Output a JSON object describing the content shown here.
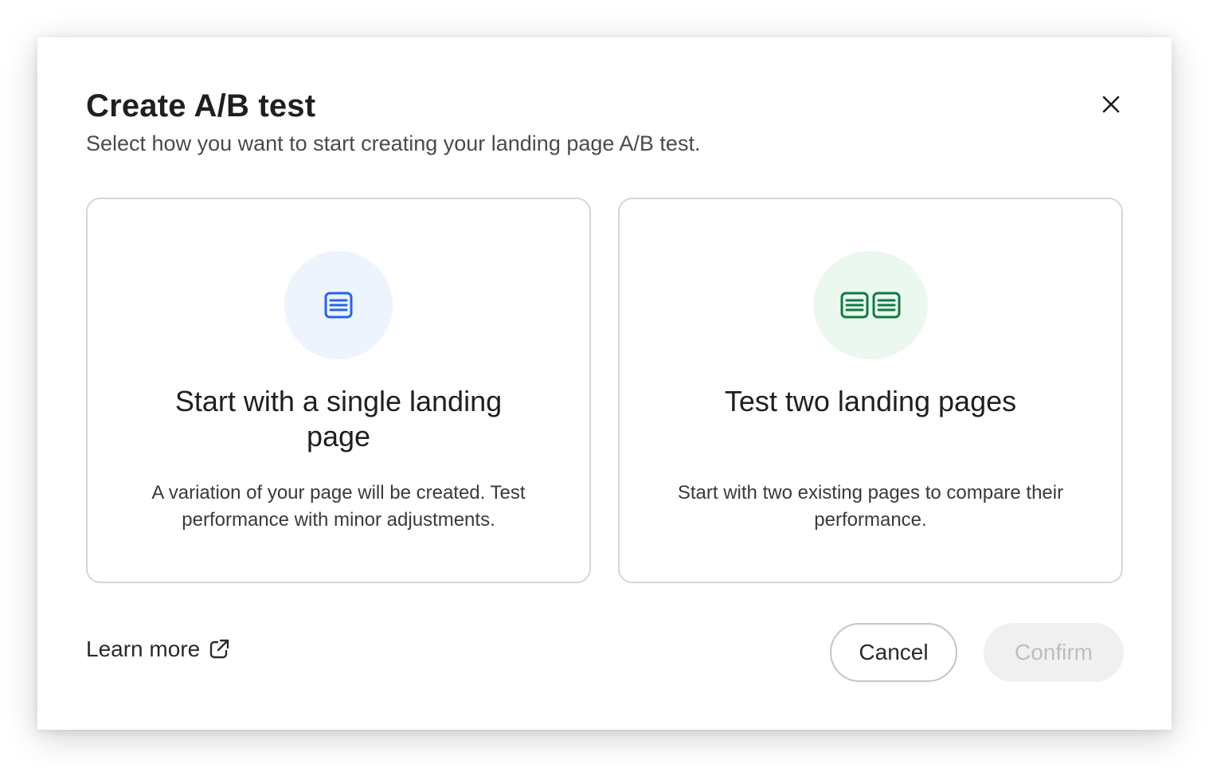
{
  "dialog": {
    "title": "Create A/B test",
    "subtitle": "Select how you want to start creating your landing page A/B test.",
    "close_icon": "close-icon"
  },
  "options": [
    {
      "icon": "single-page-icon",
      "icon_color": "#2563eb",
      "icon_bg": "#eef4fd",
      "title": "Start with a single landing page",
      "description": "A variation of your page will be created. Test performance with minor adjustments."
    },
    {
      "icon": "two-pages-icon",
      "icon_color": "#0f7a45",
      "icon_bg": "#ebf8ef",
      "title": "Test two landing pages",
      "description": "Start with two existing pages to compare their performance."
    }
  ],
  "footer": {
    "learn_more_label": "Learn more",
    "learn_more_icon": "external-link-icon",
    "cancel_label": "Cancel",
    "confirm_label": "Confirm",
    "confirm_disabled": true
  }
}
